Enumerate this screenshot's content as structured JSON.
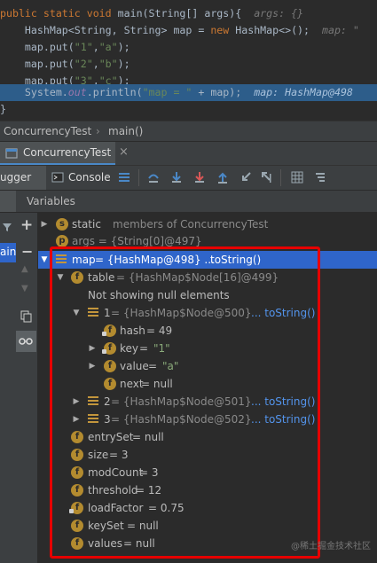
{
  "editor": {
    "lines": [
      {
        "parts": [
          [
            "kw",
            "public static void "
          ],
          [
            "id",
            "main(String[] args){  "
          ],
          [
            "hint",
            "args: {}"
          ]
        ]
      },
      {
        "parts": [
          [
            "id",
            "    HashMap<String, String> map = "
          ],
          [
            "kw",
            "new "
          ],
          [
            "id",
            "HashMap<>();  "
          ],
          [
            "hint",
            "map: \""
          ]
        ]
      },
      {
        "parts": [
          [
            "id",
            "    map.put("
          ],
          [
            "str",
            "\"1\""
          ],
          [
            "id",
            ","
          ],
          [
            "str",
            "\"a\""
          ],
          [
            "id",
            ");"
          ]
        ]
      },
      {
        "parts": [
          [
            "id",
            "    map.put("
          ],
          [
            "str",
            "\"2\""
          ],
          [
            "id",
            ","
          ],
          [
            "str",
            "\"b\""
          ],
          [
            "id",
            ");"
          ]
        ]
      },
      {
        "parts": [
          [
            "id",
            "    map.put("
          ],
          [
            "str",
            "\"3\""
          ],
          [
            "id",
            ","
          ],
          [
            "str",
            "\"c\""
          ],
          [
            "id",
            ");"
          ]
        ]
      },
      {
        "parts": [
          [
            "id",
            "    System."
          ],
          [
            "fld",
            "out"
          ],
          [
            "id",
            ".println("
          ],
          [
            "str",
            "\"map = \""
          ],
          [
            "id",
            " + map);  "
          ],
          [
            "hinthl",
            "map: HashMap@498"
          ]
        ]
      },
      {
        "parts": [
          [
            "id",
            "}"
          ]
        ]
      }
    ]
  },
  "breadcrumb": {
    "class": "ConcurrencyTest",
    "method": "main()"
  },
  "run_tab": {
    "label": "ConcurrencyTest",
    "close": "×"
  },
  "debug_tabs": {
    "debugger": "ugger",
    "console": "Console"
  },
  "variables_header": "Variables",
  "left_strip_label": "ain",
  "tree": {
    "static_row": {
      "keyword": "static",
      "text": "members of ConcurrencyTest"
    },
    "args_row": {
      "text": "args = {String[0]@497}"
    },
    "map_row": {
      "name": "map",
      "value": " = {HashMap@498} ...",
      "link": "toString()"
    },
    "table_row": {
      "name": "table",
      "value": " = {HashMap$Node[16]@499}"
    },
    "null_note": "Not showing null elements",
    "node1": {
      "name": "1",
      "value": " = {HashMap$Node@500}",
      "link": "... toString()"
    },
    "hash": {
      "name": "hash",
      "value": " = 49"
    },
    "key": {
      "name": "key",
      "eq": " = ",
      "value": "\"1\""
    },
    "value": {
      "name": "value",
      "eq": " = ",
      "value": "\"a\""
    },
    "next": {
      "name": "next",
      "value": " = null"
    },
    "node2": {
      "name": "2",
      "value": " = {HashMap$Node@501}",
      "link": "... toString()"
    },
    "node3": {
      "name": "3",
      "value": " = {HashMap$Node@502}",
      "link": "... toString()"
    },
    "fields": [
      {
        "name": "entrySet",
        "value": " = null"
      },
      {
        "name": "size",
        "value": " = 3"
      },
      {
        "name": "modCount",
        "value": " = 3"
      },
      {
        "name": "threshold",
        "value": " = 12"
      },
      {
        "name": "loadFactor",
        "value": " = 0.75"
      },
      {
        "name": "keySet",
        "value": " = null"
      },
      {
        "name": "values",
        "value": " = null"
      }
    ],
    "icon_letters": {
      "field": "f",
      "static": "s",
      "param": "p"
    }
  },
  "watermark": "@稀土掘金技术社区",
  "colors": {
    "selection": "#2f65ca",
    "highlight": "#2d5d8a",
    "annotation": "#e60000",
    "field_icon": "#b38b2f"
  }
}
